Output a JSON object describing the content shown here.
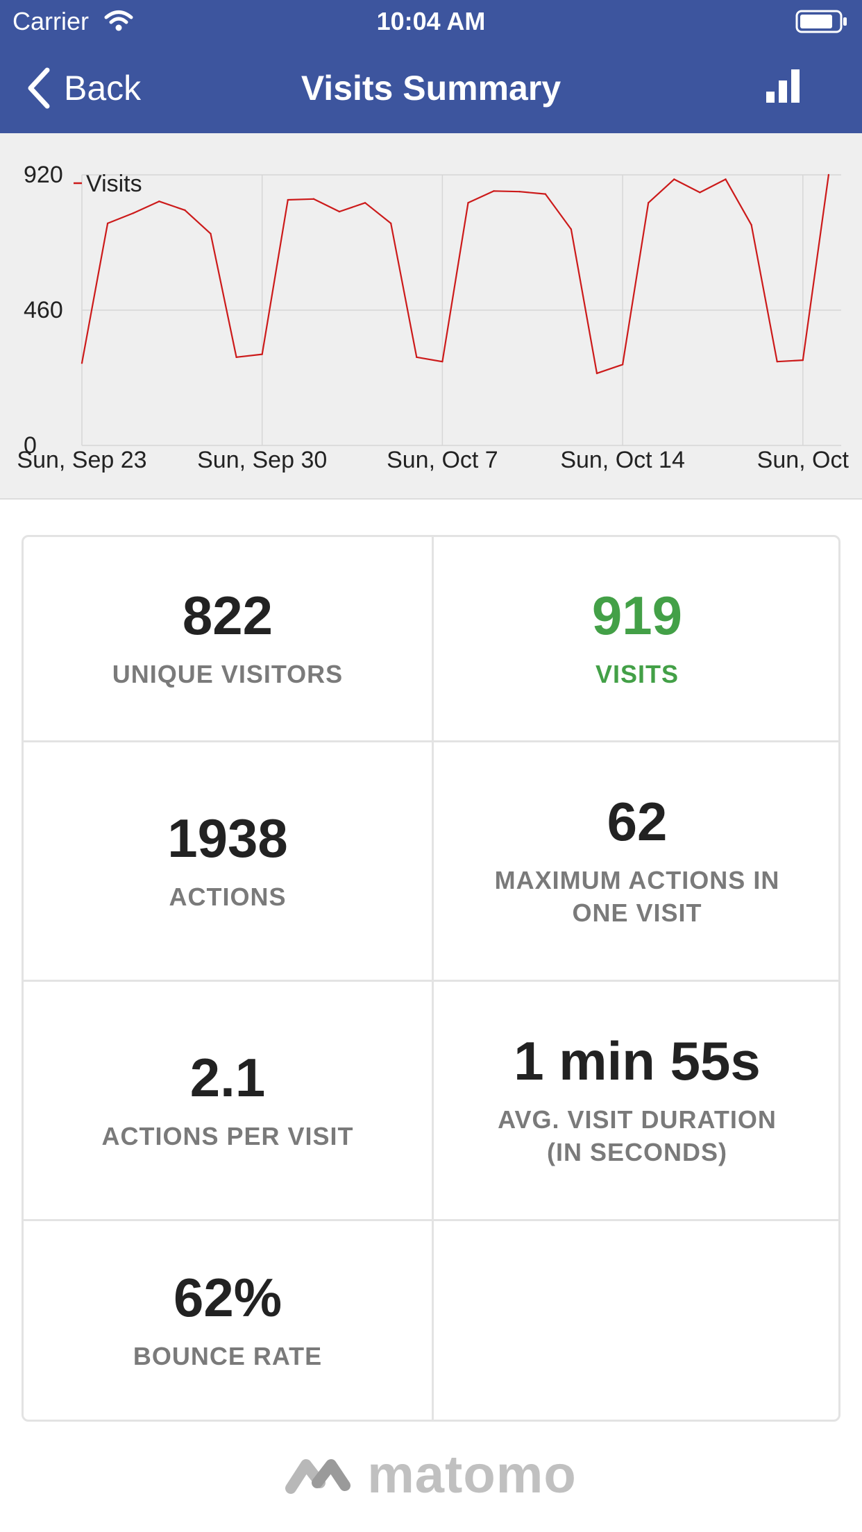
{
  "status_bar": {
    "carrier": "Carrier",
    "time": "10:04 AM"
  },
  "nav": {
    "back_label": "Back",
    "title": "Visits Summary"
  },
  "chart_data": {
    "type": "line",
    "series": [
      {
        "name": "Visits",
        "color": "#cc1a1a",
        "values": [
          280,
          755,
          790,
          830,
          800,
          720,
          300,
          310,
          835,
          838,
          795,
          825,
          755,
          300,
          285,
          825,
          865,
          863,
          855,
          735,
          245,
          275,
          825,
          905,
          860,
          905,
          750,
          285,
          290,
          920
        ]
      }
    ],
    "x_tick_labels": [
      "Sun, Sep 23",
      "Sun, Sep 30",
      "Sun, Oct 7",
      "Sun, Oct 14",
      "Sun, Oct"
    ],
    "x_tick_indices": [
      0,
      7,
      14,
      21,
      28
    ],
    "y_tick_labels": [
      "0",
      "460",
      "920"
    ],
    "y_ticks": [
      0,
      460,
      920
    ],
    "ylim": [
      0,
      920
    ],
    "grid": true,
    "legend_placement": "top-left"
  },
  "stats": [
    {
      "value": "822",
      "label": "UNIQUE VISITORS"
    },
    {
      "value": "919",
      "label": "VISITS"
    },
    {
      "value": "1938",
      "label": "ACTIONS"
    },
    {
      "value": "62",
      "label": "MAXIMUM ACTIONS IN ONE VISIT"
    },
    {
      "value": "2.1",
      "label": "ACTIONS PER VISIT"
    },
    {
      "value": "1 min 55s",
      "label": "AVG. VISIT DURATION (IN SECONDS)"
    },
    {
      "value": "62%",
      "label": "BOUNCE RATE"
    }
  ],
  "footer": {
    "brand": "matomo"
  }
}
